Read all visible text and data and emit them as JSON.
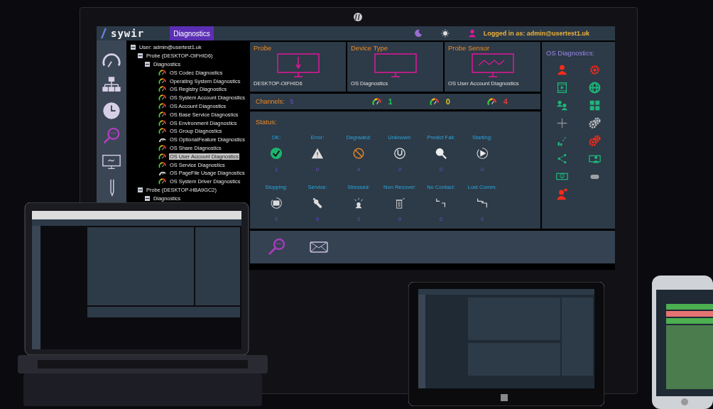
{
  "header": {
    "logo": "sywir",
    "tab": {
      "label": "Diagnostics",
      "selected": true
    },
    "user": "Logged in as: admin@usertest1.uk"
  },
  "nav": [
    {
      "kind": "gauge",
      "selected": false
    },
    {
      "kind": "network",
      "selected": false
    },
    {
      "kind": "clock",
      "selected": false
    },
    {
      "kind": "search",
      "selected": true
    },
    {
      "kind": "monitor",
      "selected": false
    },
    {
      "kind": "probe",
      "selected": false
    }
  ],
  "tree": [
    {
      "label": "User: admin@usertest1.uk",
      "expanded": true,
      "children": [
        {
          "label": "Probe (DESKTOP-OIFHID6)",
          "expanded": true,
          "children": [
            {
              "label": "Diagnostics",
              "expanded": true,
              "children": [
                {
                  "label": "OS Codec Diagnostics",
                  "kind": "gauge",
                  "selected": false
                },
                {
                  "label": "Operating System Diagnostics",
                  "kind": "gauge",
                  "selected": false
                },
                {
                  "label": "OS Registry Diagnostics",
                  "kind": "gauge",
                  "selected": false
                },
                {
                  "label": "OS System Account Diagnostics",
                  "kind": "gauge",
                  "selected": false
                },
                {
                  "label": "OS Account Diagnostics",
                  "kind": "gauge",
                  "selected": false
                },
                {
                  "label": "OS Base Service Diagnostics",
                  "kind": "gauge",
                  "selected": false
                },
                {
                  "label": "OS Environment Diagnostics",
                  "kind": "gauge",
                  "selected": false
                },
                {
                  "label": "OS Group Diagnostics",
                  "kind": "gauge",
                  "selected": false
                },
                {
                  "label": "OS OptionalFeature Diagnostics",
                  "kind": "gauge-idle",
                  "selected": false
                },
                {
                  "label": "OS Share Diagnostics",
                  "kind": "gauge",
                  "selected": false
                },
                {
                  "label": "OS User Account Diagnostics",
                  "kind": "gauge",
                  "selected": true
                },
                {
                  "label": "OS Service Diagnostics",
                  "kind": "gauge",
                  "selected": false
                },
                {
                  "label": "OS PageFile Usage Diagnostics",
                  "kind": "gauge-idle",
                  "selected": false
                },
                {
                  "label": "OS System Driver Diagnostics",
                  "kind": "gauge",
                  "selected": false
                }
              ]
            }
          ]
        },
        {
          "label": "Probe (DESKTOP-HBA9GC2)",
          "expanded": true,
          "children": [
            {
              "label": "Diagnostics",
              "expanded": true
            }
          ]
        }
      ]
    }
  ],
  "cards": [
    {
      "title": "Probe",
      "kind": "probe",
      "value": "DESKTOP-OIFHID6"
    },
    {
      "title": "Device Type",
      "kind": "blank",
      "value": "OS Diagnostics"
    },
    {
      "title": "Probe Sensor",
      "kind": "wave",
      "value": "OS User Account Diagnostics"
    }
  ],
  "channels": {
    "label": "Channels:",
    "count": "5",
    "gauges": [
      {
        "value": "1",
        "color": "#22c55e"
      },
      {
        "value": "0",
        "color": "#d4c92a"
      },
      {
        "value": "4",
        "color": "#e53935"
      }
    ]
  },
  "status": {
    "title": "Status:",
    "items": [
      {
        "label": "OK:",
        "kind": "ok",
        "count": "1"
      },
      {
        "label": "Error:",
        "kind": "error",
        "count": "0"
      },
      {
        "label": "Degraded:",
        "kind": "degraded",
        "count": "4"
      },
      {
        "label": "Unknown:",
        "kind": "unknown",
        "count": "0"
      },
      {
        "label": "Predict Fail:",
        "kind": "predict",
        "count": "0"
      },
      {
        "label": "Starting:",
        "kind": "starting",
        "count": "0"
      },
      {
        "label": "Stopping:",
        "kind": "stopping",
        "count": "0"
      },
      {
        "label": "Service:",
        "kind": "service",
        "count": "0"
      },
      {
        "label": "Stressed:",
        "kind": "stressed",
        "count": "0"
      },
      {
        "label": "Non Recover:",
        "kind": "nonrecover",
        "count": "0"
      },
      {
        "label": "No Contact:",
        "kind": "nocontact",
        "count": "0"
      },
      {
        "label": "Lost Comm:",
        "kind": "lostcomm",
        "count": "0"
      }
    ]
  },
  "os_diagnostics": {
    "title": "OS Diagnostics:",
    "icons": [
      {
        "kind": "person",
        "color": "#ff2a1a"
      },
      {
        "kind": "gear",
        "color": "#ff2a1a"
      },
      {
        "kind": "film",
        "color": "#1fb57a"
      },
      {
        "kind": "globe",
        "color": "#1fb57a"
      },
      {
        "kind": "people",
        "color": "#1fb57a"
      },
      {
        "kind": "grid",
        "color": "#1fb57a"
      },
      {
        "kind": "plus",
        "color": "#8a8f96"
      },
      {
        "kind": "gears",
        "color": "#b9bcc0"
      },
      {
        "kind": "chart",
        "color": "#1fb57a"
      },
      {
        "kind": "gears",
        "color": "#ff2a1a"
      },
      {
        "kind": "share",
        "color": "#1fb57a"
      },
      {
        "kind": "person-screen",
        "color": "#1fb57a"
      },
      {
        "kind": "screen",
        "color": "#1fb57a"
      },
      {
        "kind": "pill",
        "color": "#9ea2a6"
      },
      {
        "kind": "person-alert",
        "color": "#ff2a1a"
      }
    ]
  },
  "toolbar": [
    {
      "kind": "search"
    },
    {
      "kind": "mail"
    }
  ]
}
